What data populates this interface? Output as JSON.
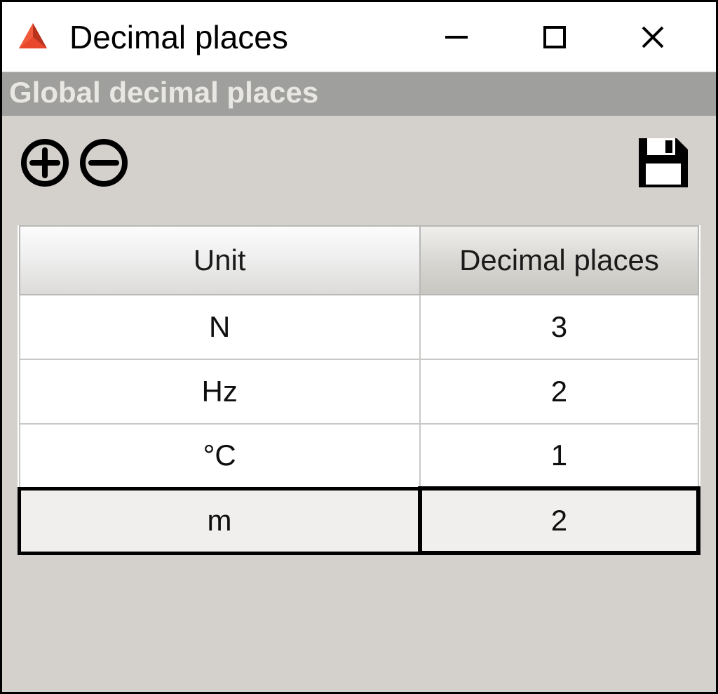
{
  "titlebar": {
    "title": "Decimal places"
  },
  "panel": {
    "header": "Global decimal places"
  },
  "table": {
    "columns": {
      "unit": "Unit",
      "decimals": "Decimal places"
    },
    "rows": [
      {
        "unit": "N",
        "decimals": "3"
      },
      {
        "unit": "Hz",
        "decimals": "2"
      },
      {
        "unit": "°C",
        "decimals": "1"
      },
      {
        "unit": "m",
        "decimals": "2"
      }
    ]
  }
}
